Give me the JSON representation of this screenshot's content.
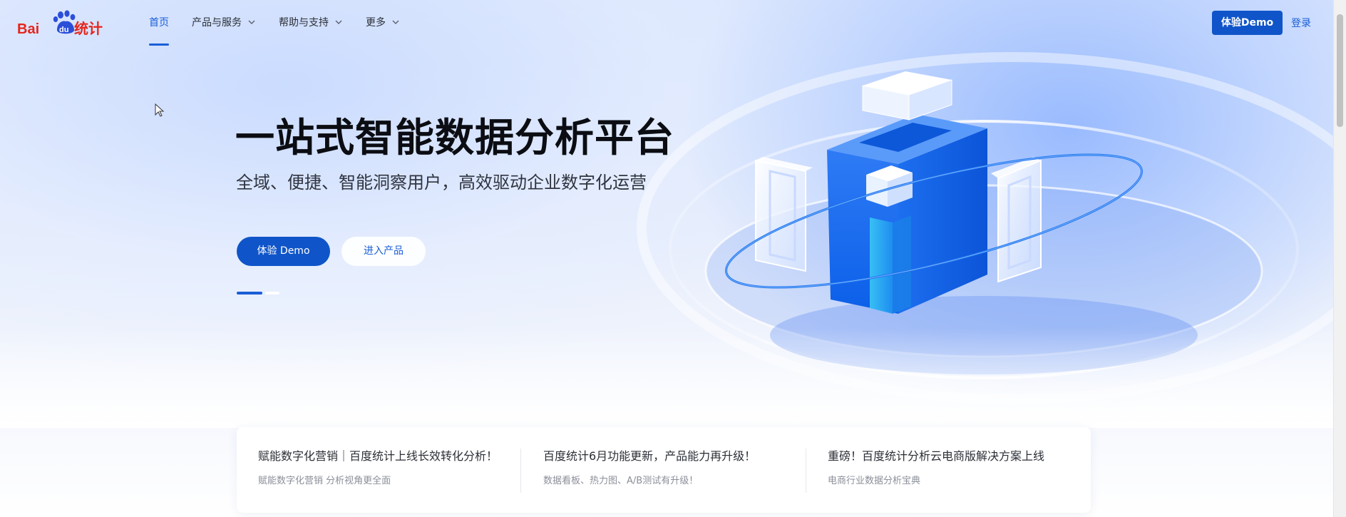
{
  "brand": {
    "logo_text_latin": "Bai",
    "logo_text_du": "du",
    "logo_text_cn": "统计",
    "color": "#e5261d",
    "paw_color": "#2b4ed9"
  },
  "nav": {
    "items": [
      {
        "label": "首页",
        "active": true
      },
      {
        "label": "产品与服务",
        "dropdown": true
      },
      {
        "label": "帮助与支持",
        "dropdown": true
      },
      {
        "label": "更多",
        "dropdown": true
      }
    ]
  },
  "header": {
    "demo_button": "体验Demo",
    "login": "登录"
  },
  "hero": {
    "title": "一站式智能数据分析平台",
    "subtitle": "全域、便捷、智能洞察用户，高效驱动企业数字化运营",
    "primary_button": "体验 Demo",
    "secondary_button": "进入产品",
    "carousel": {
      "slides": 2,
      "active_index": 0
    }
  },
  "news": [
    {
      "title": "赋能数字化营销｜百度统计上线长效转化分析！",
      "desc": "赋能数字化营销 分析视角更全面"
    },
    {
      "title": "百度统计6月功能更新，产品能力再升级！",
      "desc": "数据看板、热力图、A/B测试有升级！"
    },
    {
      "title": "重磅！百度统计分析云电商版解决方案上线",
      "desc": "电商行业数据分析宝典"
    }
  ],
  "colors": {
    "accent": "#1a5ed6",
    "button": "#0f55c9"
  }
}
